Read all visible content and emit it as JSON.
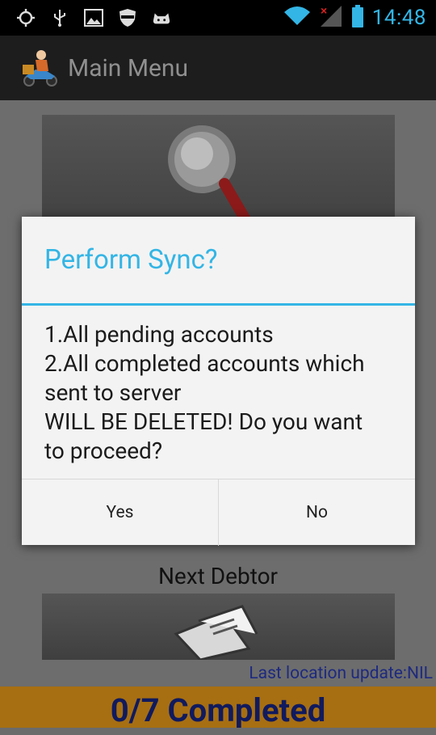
{
  "status_bar": {
    "time": "14:48",
    "left_icons": [
      "gps-icon",
      "usb-icon",
      "image-icon",
      "shield-icon",
      "game-controller-icon"
    ],
    "right_icons": [
      "wifi-icon",
      "signal-icon",
      "battery-icon"
    ]
  },
  "action_bar": {
    "title": "Main Menu",
    "app_icon": "delivery-scooter-icon"
  },
  "main": {
    "tiles": [
      {
        "icon": "magnifier-icon"
      },
      {
        "label": "Next Debtor"
      },
      {
        "icon": "document-icon"
      }
    ],
    "location_text": "Last location update:NIL",
    "progress_text": "0/7 Completed"
  },
  "dialog": {
    "title": "Perform Sync?",
    "message_lines": [
      "1.All pending accounts",
      "2.All completed accounts which",
      "sent to server",
      "WILL BE DELETED! Do you want",
      "to proceed?"
    ],
    "buttons": {
      "yes": "Yes",
      "no": "No"
    }
  },
  "colors": {
    "accent": "#33b5e5",
    "bottom_bar": "#a76f12",
    "status_text": "#1e2a80"
  }
}
